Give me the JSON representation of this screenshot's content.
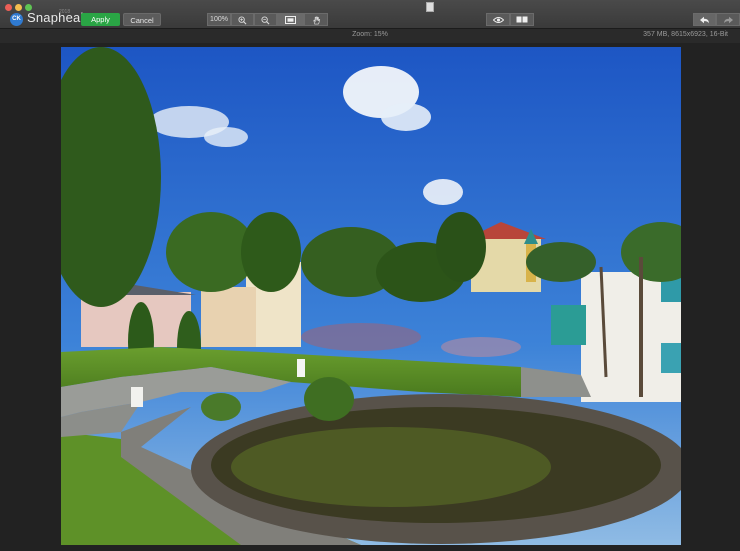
{
  "app": {
    "name": "Snapheal",
    "version": "2018",
    "logo_initials": "CK"
  },
  "toolbar": {
    "apply_label": "Apply",
    "cancel_label": "Cancel",
    "zoom_level": "100%"
  },
  "status": {
    "zoom_text": "Zoom: 15%",
    "image_info": "357 MB, 8615x6923, 16-Bit"
  },
  "icons": [
    "close-icon",
    "minimize-icon",
    "maximize-icon",
    "document-icon",
    "zoom-in-icon",
    "zoom-out-icon",
    "fit-screen-icon",
    "hand-icon",
    "eye-icon",
    "compare-icon",
    "undo-icon",
    "redo-icon"
  ],
  "colors": {
    "apply": "#2aa545",
    "toolbar": "#3f3f3f",
    "background": "#222222"
  }
}
